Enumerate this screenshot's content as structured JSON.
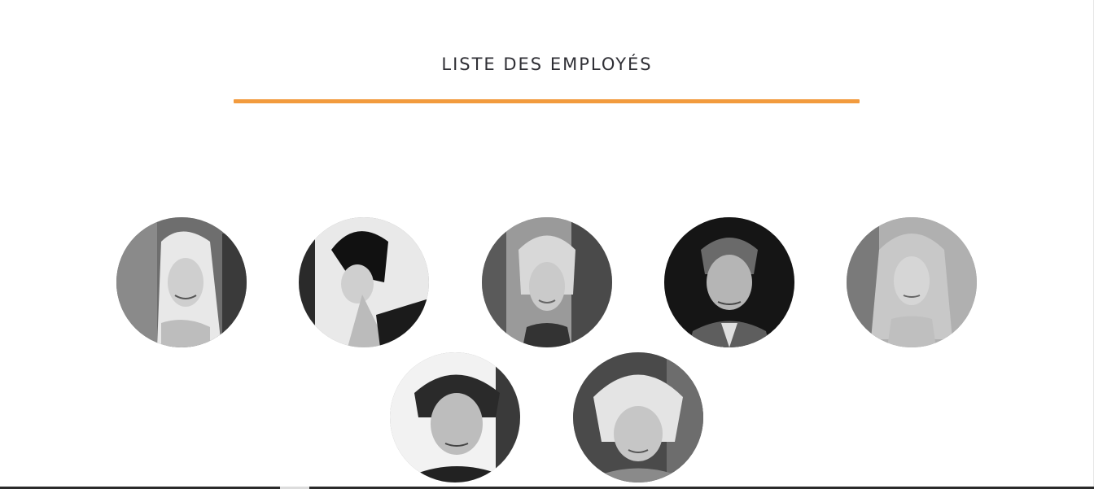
{
  "page": {
    "title": "LISTE DES EMPLOYÉS",
    "accent_color": "#f29b3e"
  },
  "employees": [
    {
      "photo": "employee-photo-1"
    },
    {
      "photo": "employee-photo-2"
    },
    {
      "photo": "employee-photo-3"
    },
    {
      "photo": "employee-photo-4"
    },
    {
      "photo": "employee-photo-5"
    },
    {
      "photo": "employee-photo-6"
    },
    {
      "photo": "employee-photo-7"
    }
  ]
}
